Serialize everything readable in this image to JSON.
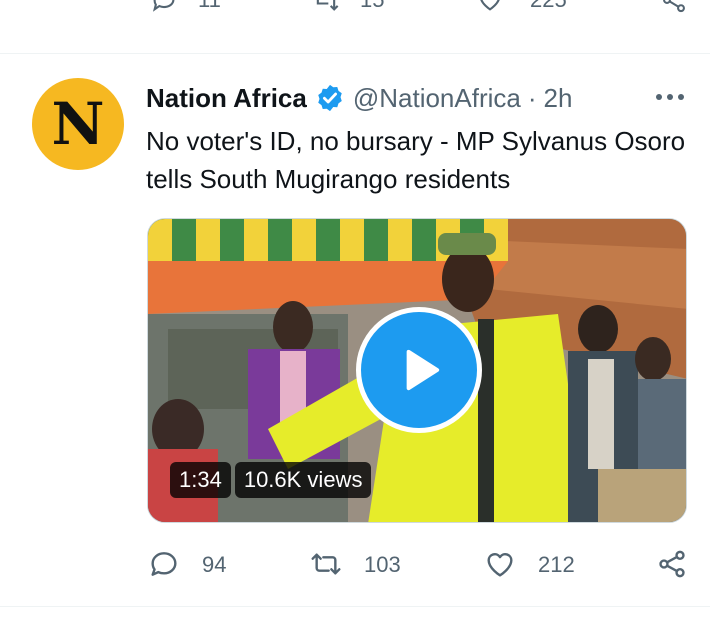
{
  "previous_tweet": {
    "reply_count": "11",
    "retweet_count": "15",
    "like_count": "225"
  },
  "tweet": {
    "display_name": "Nation Africa",
    "handle": "@NationAfrica",
    "separator": "·",
    "time": "2h",
    "avatar_letter": "N",
    "text": "No voter's ID, no bursary - MP Sylvanus Osoro tells South Mugirango residents",
    "video": {
      "duration": "1:34",
      "views": "10.6K views"
    },
    "counts": {
      "replies": "94",
      "retweets": "103",
      "likes": "212"
    }
  },
  "colors": {
    "accent": "#1d9bf0",
    "avatar_bg": "#f6b821",
    "muted_text": "#536471"
  },
  "icons": {
    "verified": "verified-badge-icon",
    "more": "more-dots-icon",
    "reply": "reply-icon",
    "retweet": "retweet-icon",
    "like": "heart-icon",
    "share": "share-icon",
    "play": "play-icon"
  }
}
